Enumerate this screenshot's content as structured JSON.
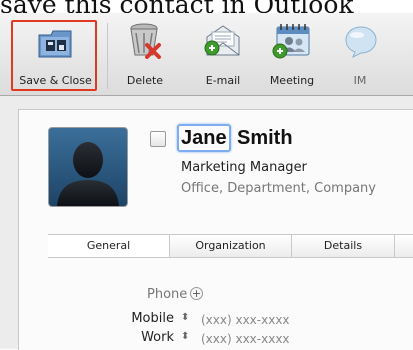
{
  "caption": "save this contact in Outlook",
  "toolbar": {
    "save_close": "Save & Close",
    "delete": "Delete",
    "email": "E-mail",
    "meeting": "Meeting",
    "im": "IM"
  },
  "contact": {
    "first_name": "Jane",
    "last_name": "Smith",
    "job_title": "Marketing Manager",
    "org_line": "Office, Department, Company"
  },
  "tabs": [
    "General",
    "Organization",
    "Details"
  ],
  "phone": {
    "header": "Phone",
    "rows": [
      {
        "label": "Mobile",
        "value": "(xxx) xxx-xxxx"
      },
      {
        "label": "Work",
        "value": "(xxx) xxx-xxxx"
      }
    ]
  },
  "colors": {
    "highlight": "#e0391f",
    "focus": "#7eaef0"
  }
}
